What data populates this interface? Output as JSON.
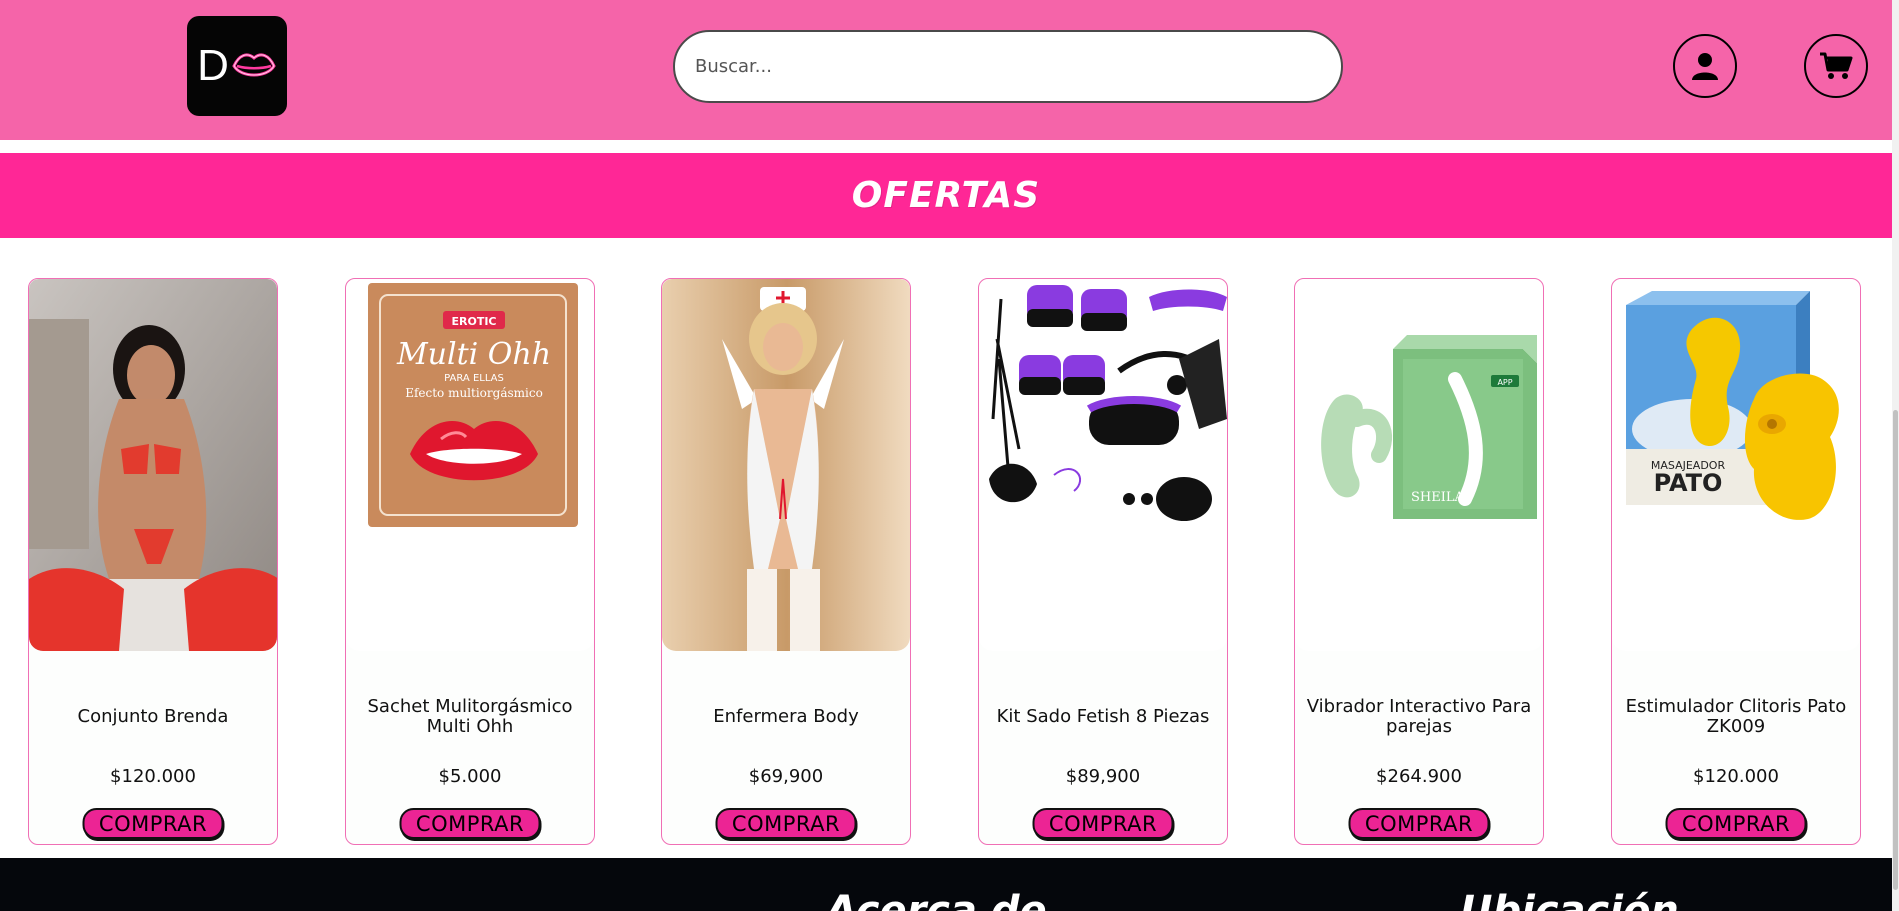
{
  "header": {
    "logo_letter": "D",
    "search_placeholder": "Buscar..."
  },
  "icons": {
    "logo": "neon-lips-icon",
    "user": "user-icon",
    "cart": "cart-icon"
  },
  "offers": {
    "title": "OFERTAS"
  },
  "products": [
    {
      "name": "Conjunto Brenda",
      "price": "$120.000",
      "buy_label": "COMPRAR",
      "image": "red-lingerie-photo"
    },
    {
      "name": "Sachet Mulitorgásmico Multi Ohh",
      "price": "$5.000",
      "buy_label": "COMPRAR",
      "image": "multi-ohh-sachet-photo",
      "image_text": {
        "brand": "EROTIC",
        "title": "Multi Ohh",
        "subtitle": "PARA ELLAS",
        "tagline": "Efecto multiorgásmico"
      }
    },
    {
      "name": "Enfermera Body",
      "price": "$69,900",
      "buy_label": "COMPRAR",
      "image": "nurse-costume-photo"
    },
    {
      "name": "Kit Sado Fetish 8 Piezas",
      "price": "$89,900",
      "buy_label": "COMPRAR",
      "image": "fetish-kit-photo"
    },
    {
      "name": "Vibrador Interactivo Para parejas",
      "price": "$264.900",
      "buy_label": "COMPRAR",
      "image": "green-vibrator-photo",
      "image_text": {
        "brand": "SHEILA",
        "app": "APP"
      }
    },
    {
      "name": "Estimulador Clitoris Pato ZK009",
      "price": "$120.000",
      "buy_label": "COMPRAR",
      "image": "yellow-duck-stimulator-photo",
      "image_text": {
        "line1": "MASAJEADOR",
        "line2": "PATO"
      }
    }
  ],
  "footer": {
    "heading_1": "Acerca de",
    "heading_2": "Ubicación"
  },
  "colors": {
    "header_bg": "#f564a9",
    "offers_bg": "#ff2796",
    "card_border": "#f06fb5",
    "button_bg": "#ec2494",
    "footer_bg": "#05070c"
  }
}
